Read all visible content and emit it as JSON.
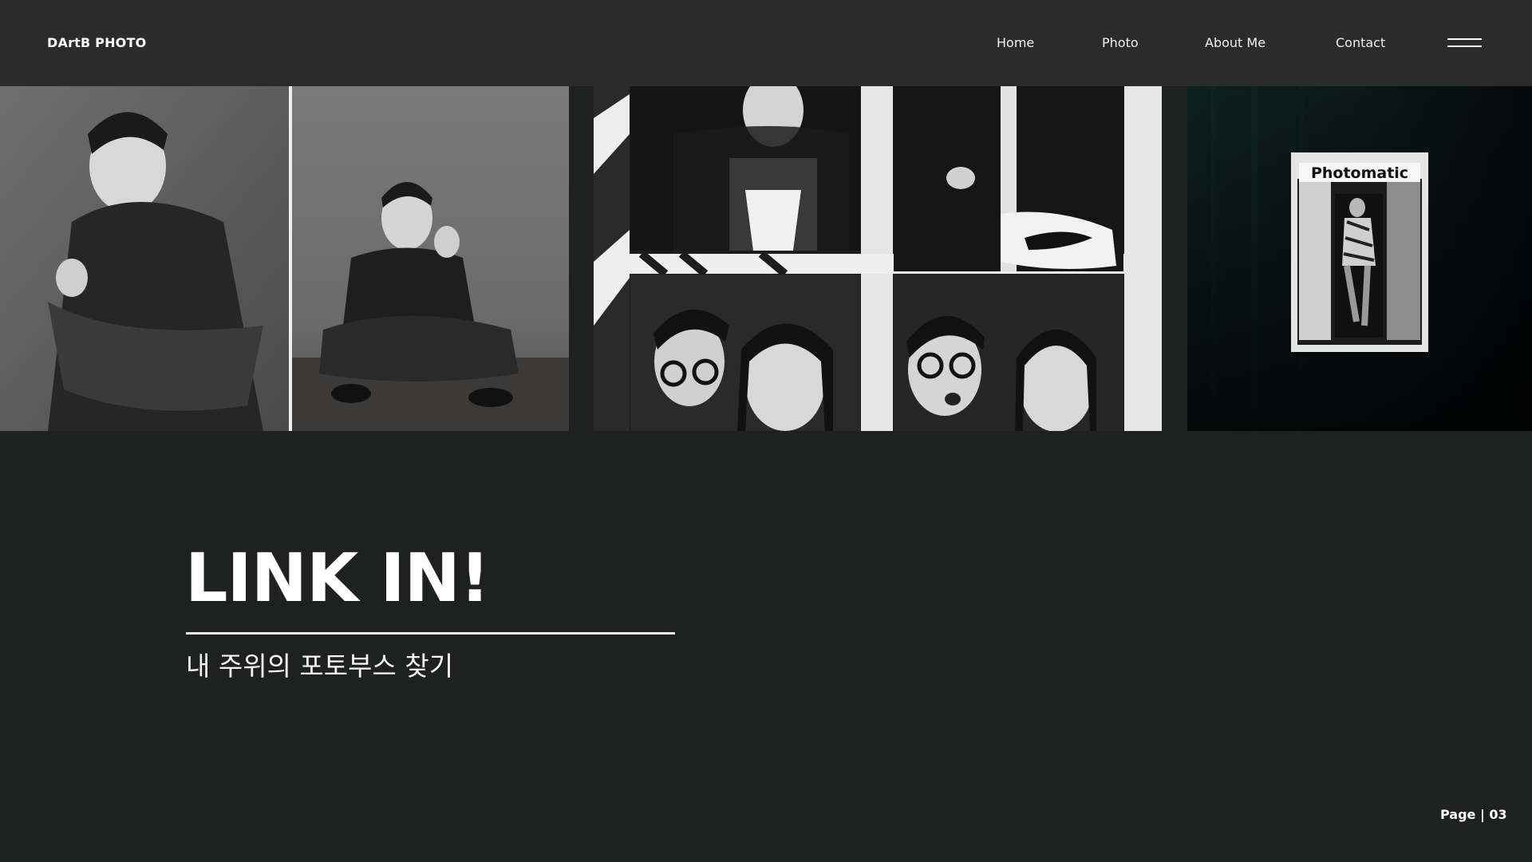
{
  "header": {
    "brand": "DArtB PHOTO",
    "nav": {
      "home": "Home",
      "photo": "Photo",
      "about": "About Me",
      "contact": "Contact"
    },
    "menu_icon": "hamburger-menu-icon"
  },
  "gallery": {
    "photo_c_sign": "Photomatic"
  },
  "main": {
    "title": "LINK IN!",
    "subtitle": "내 주위의 포토부스 찾기"
  },
  "footer": {
    "page": "Page | 03"
  }
}
